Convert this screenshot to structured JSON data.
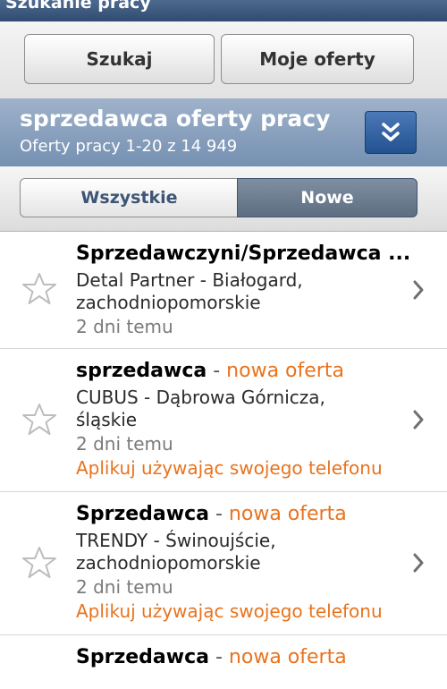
{
  "app": {
    "title": "Szukanie pracy"
  },
  "buttons": {
    "search": "Szukaj",
    "my_offers": "Moje oferty"
  },
  "search": {
    "query": "sprzedawca oferty pracy",
    "results": "Oferty pracy 1-20 z 14 949"
  },
  "tabs": {
    "all": "Wszystkie",
    "new": "Nowe",
    "selected": "Nowe"
  },
  "jobs": [
    {
      "title": "Sprzedawczyni/Sprzedawca ...",
      "company_location": "Detal Partner -  Białogard,",
      "region": "zachodniopomorskie",
      "date": "2 dni temu"
    },
    {
      "title": "sprzedawca",
      "sep": " - ",
      "badge": "nowa oferta",
      "company_location": "CUBUS -  Dąbrowa Górnicza,",
      "region": "śląskie",
      "date": "2 dni temu",
      "apply": "Aplikuj używając swojego telefonu"
    },
    {
      "title": "Sprzedawca",
      "sep": " - ",
      "badge": "nowa oferta",
      "company_location": "TRENDY -  Świnoujście,",
      "region": "zachodniopomorskie",
      "date": "2 dni temu",
      "apply": "Aplikuj używając swojego telefonu"
    },
    {
      "title": "Sprzedawca",
      "sep": " - ",
      "badge": "nowa oferta"
    }
  ],
  "colors": {
    "accent_orange": "#e8731e",
    "header_blue": "#7590b2",
    "button_blue": "#22528f"
  }
}
